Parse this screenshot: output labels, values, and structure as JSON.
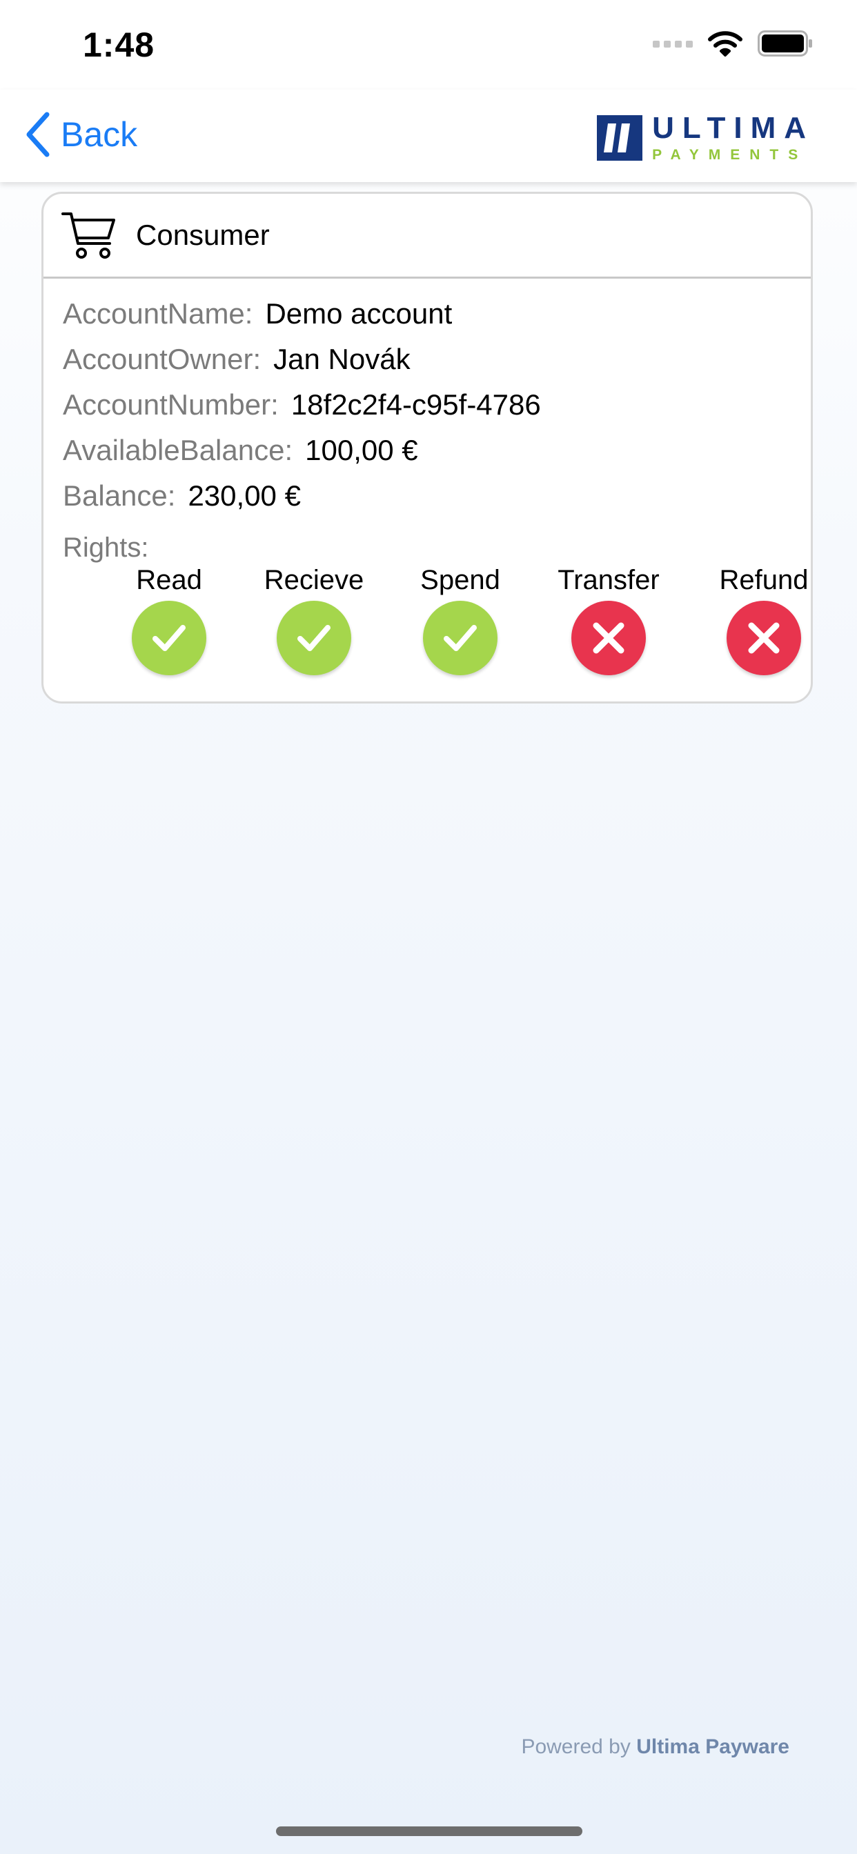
{
  "status_bar": {
    "time": "1:48"
  },
  "nav": {
    "back_label": "Back",
    "logo_word": "ULTIMA",
    "logo_sub": "PAYMENTS"
  },
  "account": {
    "title": "Consumer",
    "icon": "shopping-cart-icon",
    "fields": [
      {
        "label": "AccountName:",
        "value": "Demo account"
      },
      {
        "label": "AccountOwner:",
        "value": "Jan Novák"
      },
      {
        "label": "AccountNumber:",
        "value": "18f2c2f4-c95f-4786"
      },
      {
        "label": "AvailableBalance:",
        "value": "100,00 €"
      },
      {
        "label": "Balance:",
        "value": "230,00 €"
      }
    ],
    "rights_label": "Rights:",
    "rights": [
      {
        "name": "Read",
        "granted": true
      },
      {
        "name": "Recieve",
        "granted": true
      },
      {
        "name": "Spend",
        "granted": true
      },
      {
        "name": "Transfer",
        "granted": false
      },
      {
        "name": "Refund",
        "granted": false
      }
    ]
  },
  "footer": {
    "prefix": "Powered by",
    "brand": "Ultima Payware"
  },
  "colors": {
    "accent_blue": "#1a7cf5",
    "granted_green": "#a5d64c",
    "denied_red": "#e8344e",
    "logo_navy": "#16377f",
    "logo_green": "#93c63b"
  }
}
